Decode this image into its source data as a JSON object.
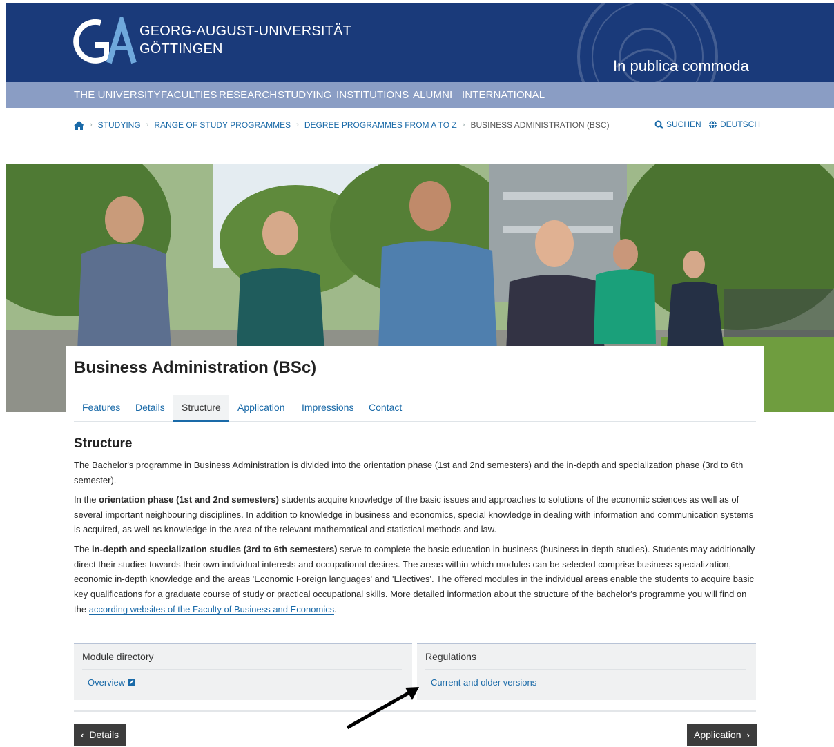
{
  "header": {
    "uni_line1": "GEORG-AUGUST-UNIVERSITÄT",
    "uni_line2": "GÖTTINGEN",
    "motto": "In publica commoda",
    "brand_color": "#1a3a7a"
  },
  "nav": {
    "items": [
      "THE UNIVERSITY",
      "FACULTIES",
      "RESEARCH",
      "STUDYING",
      "INSTITUTIONS",
      "ALUMNI",
      "INTERNATIONAL"
    ],
    "bar_color": "#8a9dc4"
  },
  "breadcrumb": {
    "home_icon": "home-icon",
    "items": [
      "Studying",
      "Range of study programmes",
      "Degree programmes from A to Z"
    ],
    "current": "Business Administration (BSc)"
  },
  "utilities": {
    "search_label": "SUCHEN",
    "language_label": "DEUTSCH"
  },
  "page": {
    "title": "Business Administration (BSc)",
    "tabs": [
      "Features",
      "Details",
      "Structure",
      "Application",
      "Impressions",
      "Contact"
    ],
    "active_tab": "Structure"
  },
  "content": {
    "section_title": "Structure",
    "p1": "The Bachelor's programme in Business Administration is divided into the orientation phase (1st and 2nd semesters) and the in-depth and specialization phase (3rd to 6th semester).",
    "p2_pre": "In the ",
    "p2_bold": "orientation phase (1st and 2nd semesters)",
    "p2_post": " students acquire knowledge of the basic issues and approaches to solutions of the economic sciences as well as of several important neighbouring disciplines. In addition to knowledge in business and economics, special knowledge in dealing with information and communication systems is acquired, as well as knowledge in the area of the relevant mathematical and statistical methods and law.",
    "p3_pre": "The ",
    "p3_bold": "in-depth and specialization studies (3rd to 6th semesters)",
    "p3_post": " serve to complete the basic education in business (business in-depth studies). Students may additionally direct their studies towards their own individual interests and occupational desires. The areas within which modules can be selected comprise business specialization, economic in-depth knowledge and the areas 'Economic Foreign languages' and 'Electives'. The offered modules in the individual areas enable the students to acquire basic key qualifications for a graduate course of study or practical occupational skills. More detailed information about the structure of the bachelor's programme you will find on the ",
    "p3_link": "according websites of the Faculty of Business and Economics",
    "p3_end": "."
  },
  "boxes": {
    "module": {
      "title": "Module directory",
      "link": "Overview"
    },
    "regulations": {
      "title": "Regulations",
      "link": "Current and older versions"
    }
  },
  "pager": {
    "prev_label": "Details",
    "next_label": "Application"
  }
}
